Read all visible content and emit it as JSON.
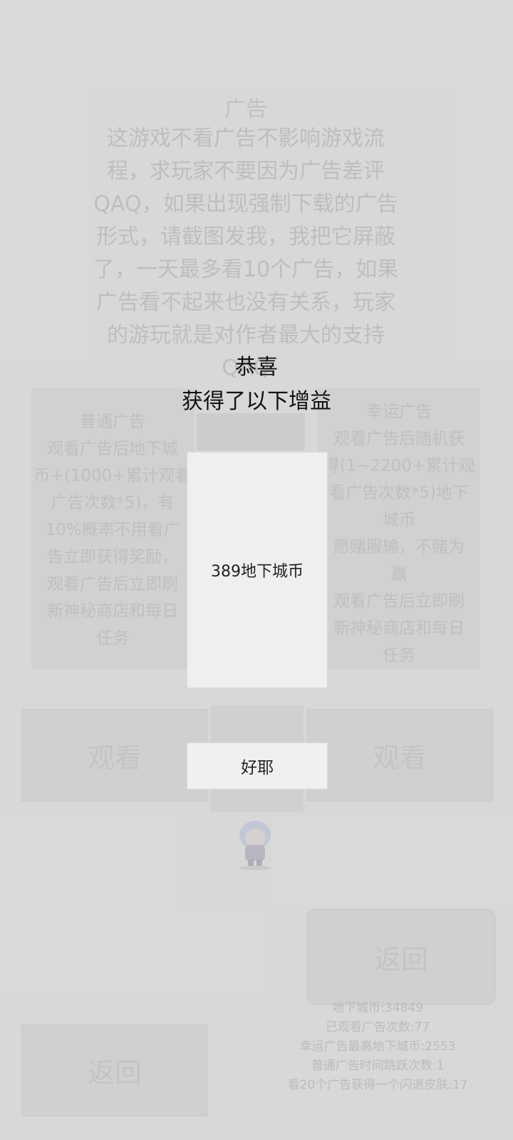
{
  "background": {
    "ad_title": "广告",
    "ad_description_lines": [
      "这游戏不看广告不影响游戏流",
      "程，求玩家不要因为广告差评",
      "QAQ，如果出现强制下载的广告",
      "形式，请截图发我，我把它屏蔽",
      "了，一天最多看10个广告，如果",
      "广告看不起来也没有关系，玩家",
      "的游玩就是对作者最大的支持",
      "QAQ"
    ],
    "normal_ad": {
      "title": "普通广告",
      "lines": [
        "观看广告后地下城",
        "币+(1000+累计观看",
        "广告次数*5)，有",
        "10%概率不用看广",
        "告立即获得奖励，",
        "观看广告后立即刷",
        "新神秘商店和每日",
        "任务"
      ],
      "watch_label": "观看"
    },
    "lucky_ad": {
      "title": "幸运广告",
      "lines": [
        "观看广告后随机获",
        "得(1~2200+累计观",
        "看广告次数*5)地下",
        "城币",
        "愿赌服输，不赌为",
        "赢",
        "观看广告后立即刷",
        "新神秘商店和每日",
        "任务"
      ],
      "watch_label": "观看"
    },
    "back_label_right": "返回",
    "back_label_left": "返回",
    "stats": [
      "地下城币:34849",
      "已观看广告次数:77",
      "幸运广告最高地下城币:2553",
      "普通广告时间跳跃次数:1",
      "看20个广告获得一个闪退皮肤:17"
    ]
  },
  "dialog": {
    "title_line1": "恭喜",
    "title_line2": "获得了以下增益",
    "reward_text": "389地下城币",
    "ok_label": "好耶"
  }
}
